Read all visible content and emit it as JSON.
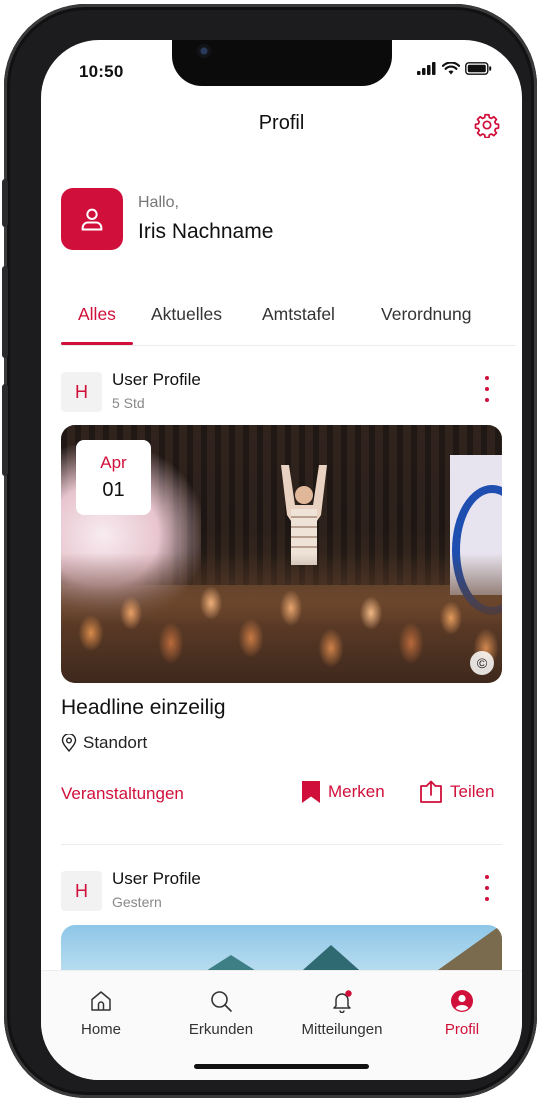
{
  "status_bar": {
    "time": "10:50"
  },
  "header": {
    "title": "Profil"
  },
  "profile": {
    "greeting": "Hallo,",
    "name": "Iris Nachname"
  },
  "tabs": [
    {
      "label": "Alles",
      "active": true
    },
    {
      "label": "Aktuelles",
      "active": false
    },
    {
      "label": "Amtstafel",
      "active": false
    },
    {
      "label": "Verordnung",
      "active": false
    }
  ],
  "posts": [
    {
      "logo_letter": "H",
      "author": "User Profile",
      "time": "5 Std",
      "date_month": "Apr",
      "date_day": "01",
      "copyright_symbol": "©",
      "headline": "Headline einzeilig",
      "location": "Standort",
      "category": "Veranstaltungen",
      "bookmark_label": "Merken",
      "share_label": "Teilen"
    },
    {
      "logo_letter": "H",
      "author": "User Profile",
      "time": "Gestern"
    }
  ],
  "bottom_nav": [
    {
      "label": "Home",
      "icon": "home-icon",
      "active": false
    },
    {
      "label": "Erkunden",
      "icon": "search-icon",
      "active": false
    },
    {
      "label": "Mitteilungen",
      "icon": "bell-icon",
      "active": false
    },
    {
      "label": "Profil",
      "icon": "user-circle-icon",
      "active": true
    }
  ],
  "colors": {
    "accent": "#d0103a",
    "text": "#111111",
    "muted": "#888888"
  }
}
